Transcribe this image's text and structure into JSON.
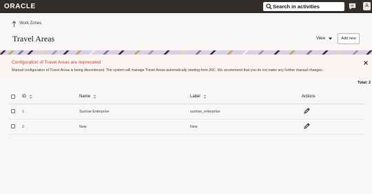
{
  "header": {
    "logo_text": "ORACLE",
    "search_placeholder": "Search in activities",
    "avatar_initial": "A"
  },
  "breadcrumb": {
    "label": "Work Zones"
  },
  "page": {
    "title": "Travel Areas",
    "view_label": "View",
    "add_new_label": "Add new"
  },
  "banner": {
    "title": "Configuration of Travel Areas are deprecated",
    "message": "Manual configuration of Travel Areas is being discontinued. The system will manage Travel Areas automatically starting from 26C. We recommend that you do not make any further manual changes."
  },
  "table": {
    "total_label": "Total: 2",
    "columns": {
      "id": "ID",
      "name": "Name",
      "label": "Label",
      "actions": "Actions"
    },
    "rows": [
      {
        "id": "1",
        "name": "Sunrise Enterprise",
        "label": "sunrise_enterprise"
      },
      {
        "id": "2",
        "name": "New",
        "label": "New"
      }
    ]
  },
  "colors": {
    "topbar": "#312d2a",
    "banner_title": "#c74634",
    "banner_bg": "#fcf4f2",
    "page_bg": "#f8f7f5"
  },
  "icons": [
    "search-icon",
    "chat-icon",
    "arrow-up-icon",
    "chevron-down-icon",
    "close-icon",
    "sort-icon",
    "edit-icon"
  ]
}
